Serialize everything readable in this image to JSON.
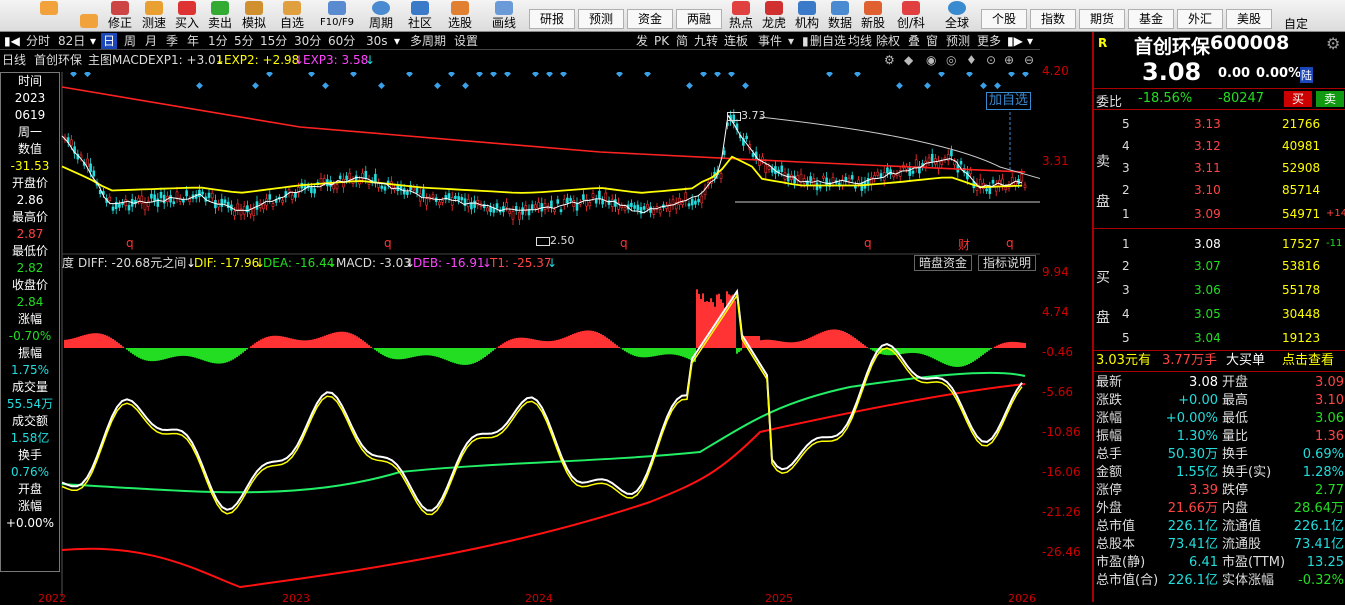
{
  "toolbar": {
    "items": [
      "",
      "",
      "修正",
      "测速",
      "买入",
      "卖出",
      "模拟",
      "自选",
      "F10/F9",
      "周期",
      "社区",
      "选股",
      "",
      "画线"
    ],
    "buttons_row": [
      {
        "top": "",
        "label": "研报"
      },
      {
        "top": "",
        "label": "预测"
      },
      {
        "top": "",
        "label": "资金"
      },
      {
        "top": "",
        "label": "两融"
      }
    ],
    "icons2": [
      "热点",
      "龙虎",
      "机构",
      "数据",
      "新股",
      "创/科",
      "全球"
    ],
    "right_buttons": [
      {
        "top": "",
        "label": "个股"
      },
      {
        "top": "",
        "label": "指数"
      },
      {
        "top": "",
        "label": "期货"
      },
      {
        "top": "",
        "label": "基金"
      },
      {
        "top": "",
        "label": "外汇"
      },
      {
        "top": "",
        "label": "美股"
      }
    ],
    "custom": "自定"
  },
  "period_bar": {
    "items": [
      "分时",
      "82日",
      "日",
      "周",
      "月",
      "季",
      "年",
      "1分",
      "5分",
      "15分",
      "30分",
      "60分",
      "30s",
      "多周期",
      "设置"
    ],
    "selected": "日",
    "right_items": [
      "发",
      "PK",
      "简",
      "九转",
      "连板",
      "事件",
      "",
      "删自选",
      "均线",
      "除权",
      "叠",
      "窗",
      "预测",
      "更多"
    ]
  },
  "info_line": {
    "period": "日线",
    "name": "首创环保",
    "chart": "主图MACD",
    "exp1": "EXP1: +3.01",
    "exp2": "EXP2: +2.98",
    "exp3": "EXP3: 3.58"
  },
  "left_panel": [
    {
      "label": "时间",
      "value": "2023"
    },
    {
      "label": "",
      "value": "0619"
    },
    {
      "label": "周一",
      "value": ""
    },
    {
      "label": "数值",
      "value": "-31.53"
    },
    {
      "label": "开盘价",
      "value": "2.86"
    },
    {
      "label": "最高价",
      "value": "2.87"
    },
    {
      "label": "最低价",
      "value": "2.82"
    },
    {
      "label": "收盘价",
      "value": "2.84"
    },
    {
      "label": "涨幅",
      "value": "-0.70%"
    },
    {
      "label": "振幅",
      "value": "1.75%"
    },
    {
      "label": "成交量",
      "value": "55.54万"
    },
    {
      "label": "成交额",
      "value": "1.58亿"
    },
    {
      "label": "换手",
      "value": "0.76%"
    },
    {
      "label": "开盘",
      "value": ""
    },
    {
      "label": "涨幅",
      "value": "+0.00%"
    }
  ],
  "price_axis": [
    "4.20",
    "3.31"
  ],
  "macd_axis": [
    "9.94",
    "4.74",
    "-0.46",
    "-5.66",
    "-10.86",
    "-16.06",
    "-21.26",
    "-26.46"
  ],
  "annotations": {
    "high": "3.73",
    "low": "2.50",
    "add_watch": "加自选",
    "q_marks": [
      "q",
      "q",
      "q",
      "q",
      "q"
    ],
    "cai": "财"
  },
  "macd_line": {
    "prefix": "度",
    "diff": "DIFF: -20.68元之间",
    "dif": "DIF: -17.96",
    "dea": "DEA: -16.44",
    "macd": "MACD: -3.03",
    "deb": "DEB: -16.91",
    "t1": "T1: -25.37"
  },
  "macd_buttons": [
    "暗盘资金",
    "指标说明"
  ],
  "x_axis": [
    "2022",
    "2023",
    "2024",
    "2025",
    "2026"
  ],
  "quote": {
    "marker": "R",
    "name": "首创环保",
    "code": "600008",
    "price": "3.08",
    "change": "0.00",
    "pct": "0.00%",
    "badge": "陆",
    "webi_label": "委比",
    "webi_pct": "-18.56%",
    "webi_val": "-80247",
    "buy": "买",
    "sell": "卖",
    "sell_label": "卖盘",
    "buy_label": "买盘",
    "asks": [
      {
        "lvl": "5",
        "price": "3.13",
        "vol": "21766",
        "chg": ""
      },
      {
        "lvl": "4",
        "price": "3.12",
        "vol": "40981",
        "chg": ""
      },
      {
        "lvl": "3",
        "price": "3.11",
        "vol": "52908",
        "chg": ""
      },
      {
        "lvl": "2",
        "price": "3.10",
        "vol": "85714",
        "chg": ""
      },
      {
        "lvl": "1",
        "price": "3.09",
        "vol": "54971",
        "chg": "+14"
      }
    ],
    "bids": [
      {
        "lvl": "1",
        "price": "3.08",
        "vol": "17527",
        "chg": "-11"
      },
      {
        "lvl": "2",
        "price": "3.07",
        "vol": "53816",
        "chg": ""
      },
      {
        "lvl": "3",
        "price": "3.06",
        "vol": "55178",
        "chg": ""
      },
      {
        "lvl": "4",
        "price": "3.05",
        "vol": "30448",
        "chg": ""
      },
      {
        "lvl": "5",
        "price": "3.04",
        "vol": "19123",
        "chg": ""
      }
    ],
    "big_order": {
      "a": "3.03元有",
      "b": "3.77万手",
      "c": "大买单",
      "d": "点击查看"
    },
    "stats": [
      [
        "最新",
        "3.08",
        "开盘",
        "3.09"
      ],
      [
        "涨跌",
        "+0.00",
        "最高",
        "3.10"
      ],
      [
        "涨幅",
        "+0.00%",
        "最低",
        "3.06"
      ],
      [
        "振幅",
        "1.30%",
        "量比",
        "1.36"
      ],
      [
        "总手",
        "50.30万",
        "换手",
        "0.69%"
      ],
      [
        "金额",
        "1.55亿",
        "换手(实)",
        "1.28%"
      ],
      [
        "涨停",
        "3.39",
        "跌停",
        "2.77"
      ],
      [
        "外盘",
        "21.66万",
        "内盘",
        "28.64万"
      ],
      [
        "总市值",
        "226.1亿",
        "流通值",
        "226.1亿"
      ],
      [
        "总股本",
        "73.41亿",
        "流通股",
        "73.41亿"
      ],
      [
        "市盈(静)",
        "6.41",
        "市盈(TTM)",
        "13.25"
      ],
      [
        "总市值(合)",
        "226.1亿",
        "实体涨幅",
        "-0.32%"
      ]
    ]
  },
  "colors": {
    "up": "#ff4444",
    "down": "#22dd22",
    "yellow": "#ffff00",
    "cyan": "#22dddd",
    "blue_sel": "#1c47b8"
  }
}
